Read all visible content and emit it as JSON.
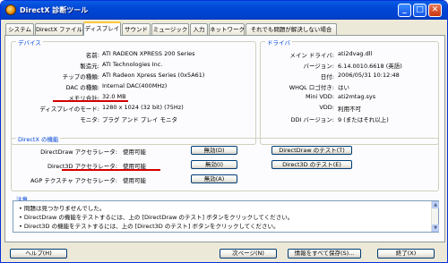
{
  "window": {
    "title": "DirectX 診断ツール",
    "minimize_glyph": "_",
    "maximize_glyph": "□",
    "close_glyph": "✕"
  },
  "tabs": [
    {
      "label": "システム"
    },
    {
      "label": "DirectX ファイル"
    },
    {
      "label": "ディスプレイ",
      "active": true
    },
    {
      "label": "サウンド"
    },
    {
      "label": "ミュージック"
    },
    {
      "label": "入力"
    },
    {
      "label": "ネットワーク"
    },
    {
      "label": "それでも問題が解決しない場合"
    }
  ],
  "device": {
    "title": "デバイス",
    "rows": [
      {
        "label": "名前:",
        "value": "ATI RADEON XPRESS 200 Series"
      },
      {
        "label": "製造元:",
        "value": "ATI Technologies Inc."
      },
      {
        "label": "チップの種類:",
        "value": "ATI Radeon Xpress Series (0x5A61)"
      },
      {
        "label": "DAC の種類:",
        "value": "Internal DAC(400MHz)"
      },
      {
        "label": "メモリ合計:",
        "value": "32.0 MB"
      },
      {
        "label": "ディスプレイのモード:",
        "value": "1280 x 1024 (32 bit) (75Hz)"
      },
      {
        "label": "モニタ:",
        "value": "プラグ アンド プレイ モニタ"
      }
    ]
  },
  "driver": {
    "title": "ドライバ",
    "rows": [
      {
        "label": "メイン ドライバ:",
        "value": "ati2dvag.dll"
      },
      {
        "label": "バージョン:",
        "value": "6.14.0010.6618 (英語)"
      },
      {
        "label": "日付:",
        "value": "2006/05/31 10:12:48"
      },
      {
        "label": "WHQL ロゴ付き:",
        "value": "はい"
      },
      {
        "label": "Mini VDD:",
        "value": "ati2mtag.sys"
      },
      {
        "label": "VDD:",
        "value": "利用不可"
      },
      {
        "label": "DDI バージョン:",
        "value": "9 (またはそれ以上)"
      }
    ]
  },
  "directx": {
    "title": "DirectX の機能",
    "rows": [
      {
        "label": "DirectDraw アクセラレータ:",
        "value": "使用可能",
        "toggle": "無効(D)",
        "test": "DirectDraw のテスト(T)"
      },
      {
        "label": "Direct3D アクセラレータ:",
        "value": "使用可能",
        "toggle": "無効(I)",
        "test": "Direct3D のテスト(E)"
      },
      {
        "label": "AGP テクスチャ アクセラレータ:",
        "value": "使用可能",
        "toggle": "無効(A)"
      }
    ]
  },
  "notes": {
    "title": "注意",
    "items": [
      "問題は見つかりませんでした。",
      "DirectDraw の機能をテストするには、上の [DirectDraw のテスト] ボタンをクリックしてください。",
      "Direct3D の機能をテストするには、上の [Direct3D のテスト] ボタンをクリックしてください。"
    ],
    "scroll_up": "▲",
    "scroll_down": "▼"
  },
  "footer": {
    "help": "ヘルプ(H)",
    "next": "次ページ(N)",
    "save": "情報をすべて保存(S)...",
    "exit": "終了(X)"
  },
  "colors": {
    "titlebar": "#0046d5",
    "group_title": "#0046d5",
    "highlight_underline": "#d40000"
  }
}
